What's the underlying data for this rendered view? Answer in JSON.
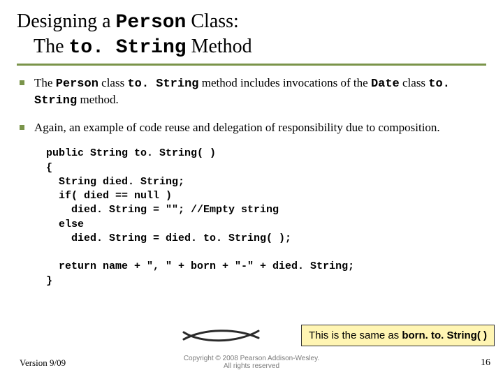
{
  "title": {
    "line1_pre": "Designing a ",
    "line1_code": "Person",
    "line1_post": " Class:",
    "line2_pre": "The ",
    "line2_code": "to. String",
    "line2_post": " Method"
  },
  "bullets": [
    {
      "parts": [
        {
          "t": "The ",
          "mono": false
        },
        {
          "t": "Person",
          "mono": true
        },
        {
          "t": " class ",
          "mono": false
        },
        {
          "t": "to. String",
          "mono": true
        },
        {
          "t": " method includes invocations of the ",
          "mono": false
        },
        {
          "t": "Date",
          "mono": true
        },
        {
          "t": " class ",
          "mono": false
        },
        {
          "t": "to. String",
          "mono": true
        },
        {
          "t": " method.",
          "mono": false
        }
      ]
    },
    {
      "parts": [
        {
          "t": "Again, an example of code reuse and delegation of responsibility due to composition.",
          "mono": false
        }
      ]
    }
  ],
  "code": "public String to. String( )\n{\n  String died. String;\n  if( died == null )\n    died. String = \"\"; //Empty string\n  else\n    died. String = died. to. String( );\n\n  return name + \", \" + born + \"-\" + died. String;\n}",
  "callout": {
    "pre": "This is the same as ",
    "bold": "born. to. String( )"
  },
  "footer": {
    "version": "Version 9/09",
    "copyright_line1": "Copyright © 2008 Pearson Addison-Wesley.",
    "copyright_line2": "All rights reserved",
    "page": "16"
  }
}
